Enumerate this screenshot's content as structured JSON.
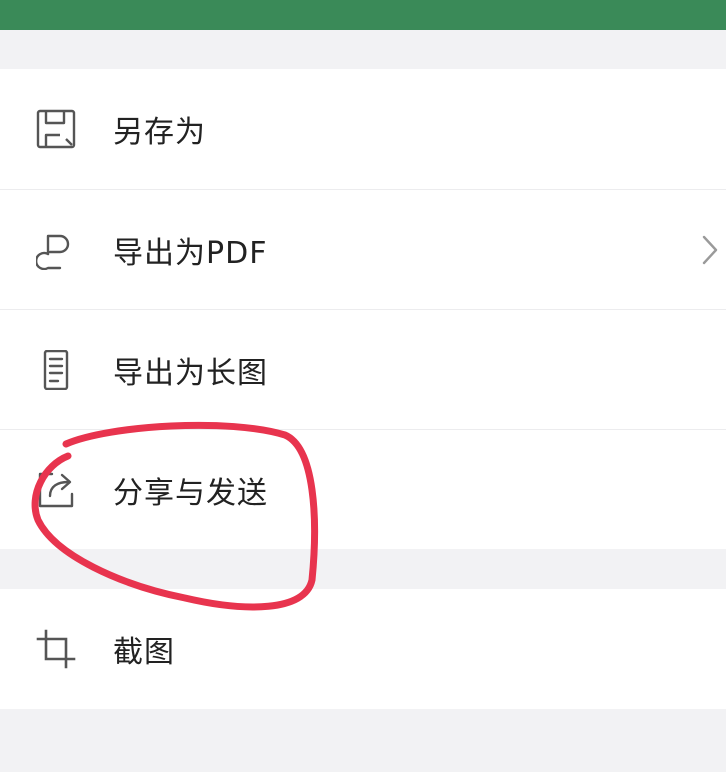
{
  "colors": {
    "header": "#3a8a58",
    "background": "#f2f2f4",
    "item_background": "#ffffff",
    "icon_stroke": "#555555",
    "text": "#222222",
    "annotation": "#e8344e"
  },
  "menu": {
    "items": [
      {
        "label": "另存为",
        "icon": "save-floppy-icon"
      },
      {
        "label": "导出为PDF",
        "icon": "pdf-export-icon",
        "has_chevron": true
      },
      {
        "label": "导出为长图",
        "icon": "long-image-icon"
      },
      {
        "label": "分享与发送",
        "icon": "share-send-icon",
        "highlighted": true
      }
    ],
    "second_group": [
      {
        "label": "截图",
        "icon": "crop-icon"
      }
    ]
  }
}
